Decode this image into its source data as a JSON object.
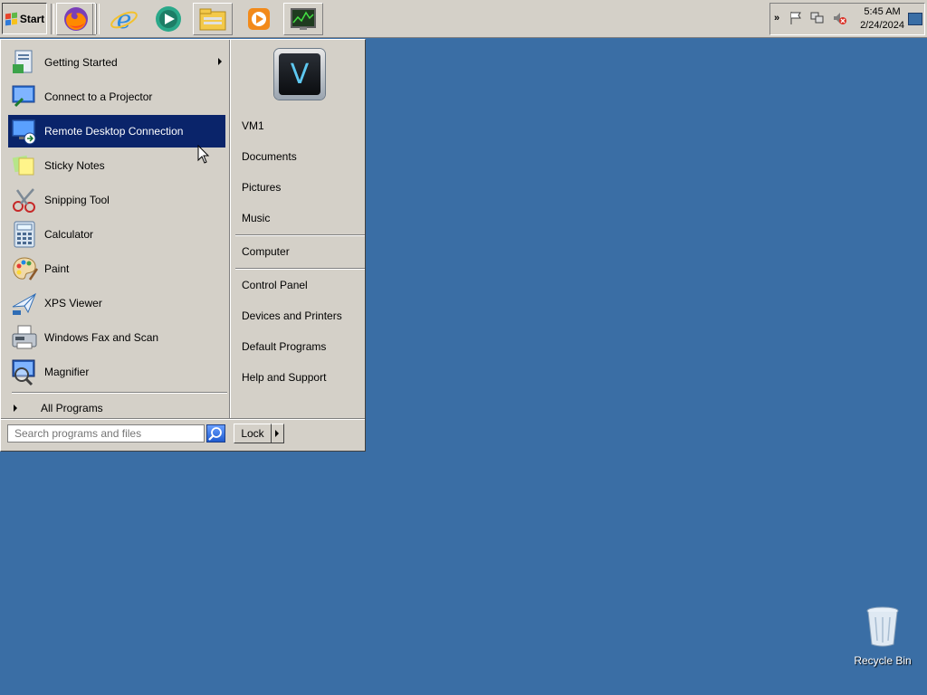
{
  "taskbar": {
    "start_label": "Start",
    "quick_launch": [
      {
        "name": "firefox-icon"
      },
      {
        "name": "internet-explorer-icon"
      },
      {
        "name": "media-center-icon"
      },
      {
        "name": "file-explorer-icon"
      },
      {
        "name": "media-player-icon"
      },
      {
        "name": "task-manager-icon"
      }
    ],
    "clock": {
      "time": "5:45 AM",
      "date": "2/24/2024"
    },
    "tray_chevron": "»"
  },
  "start_menu": {
    "programs": [
      {
        "label": "Getting Started",
        "icon": "getting-started-icon",
        "has_submenu": true,
        "selected": false
      },
      {
        "label": "Connect to a Projector",
        "icon": "projector-icon",
        "has_submenu": false,
        "selected": false
      },
      {
        "label": "Remote Desktop Connection",
        "icon": "remote-desktop-icon",
        "has_submenu": false,
        "selected": true
      },
      {
        "label": "Sticky Notes",
        "icon": "sticky-notes-icon",
        "has_submenu": false,
        "selected": false
      },
      {
        "label": "Snipping Tool",
        "icon": "scissors-icon",
        "has_submenu": false,
        "selected": false
      },
      {
        "label": "Calculator",
        "icon": "calculator-icon",
        "has_submenu": false,
        "selected": false
      },
      {
        "label": "Paint",
        "icon": "paint-palette-icon",
        "has_submenu": false,
        "selected": false
      },
      {
        "label": "XPS Viewer",
        "icon": "xps-viewer-icon",
        "has_submenu": false,
        "selected": false
      },
      {
        "label": "Windows Fax and Scan",
        "icon": "fax-icon",
        "has_submenu": false,
        "selected": false
      },
      {
        "label": "Magnifier",
        "icon": "magnifier-icon",
        "has_submenu": false,
        "selected": false
      }
    ],
    "all_programs_label": "All Programs",
    "search_placeholder": "Search programs and files",
    "user_initial": "V",
    "right_items": [
      {
        "label": "VM1",
        "name": "right-item-vm1"
      },
      {
        "label": "Documents",
        "name": "right-item-documents"
      },
      {
        "label": "Pictures",
        "name": "right-item-pictures"
      },
      {
        "label": "Music",
        "name": "right-item-music"
      },
      {
        "label": "Computer",
        "name": "right-item-computer"
      },
      {
        "label": "Control Panel",
        "name": "right-item-control-panel"
      },
      {
        "label": "Devices and Printers",
        "name": "right-item-devices-and-printers"
      },
      {
        "label": "Default Programs",
        "name": "right-item-default-programs"
      },
      {
        "label": "Help and Support",
        "name": "right-item-help-and-support"
      }
    ],
    "lock_label": "Lock"
  },
  "desktop": {
    "recycle_bin_label": "Recycle Bin"
  }
}
